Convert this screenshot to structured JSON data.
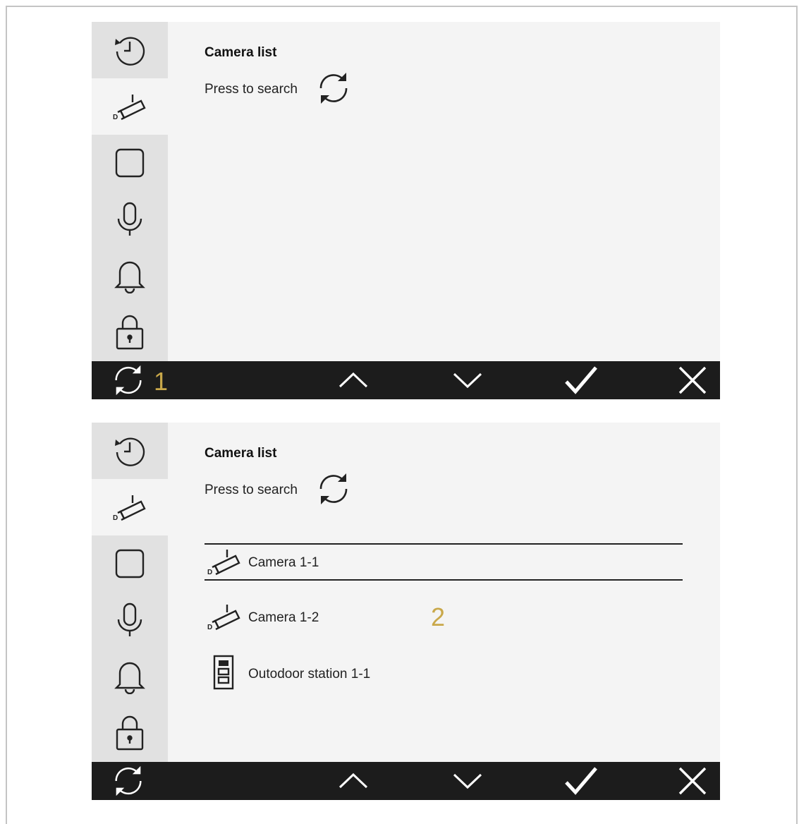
{
  "panels": [
    {
      "content": {
        "title": "Camera list",
        "search_label": "Press to search",
        "items": []
      },
      "callout": "1"
    },
    {
      "content": {
        "title": "Camera list",
        "search_label": "Press to search",
        "items": [
          {
            "icon": "camera-icon",
            "label": "Camera 1-1",
            "selected": true
          },
          {
            "icon": "camera-icon",
            "label": "Camera 1-2",
            "selected": false
          },
          {
            "icon": "outdoor-station-icon",
            "label": "Outodoor station 1-1",
            "selected": false
          }
        ]
      },
      "callout": "2"
    }
  ],
  "sidebar": {
    "items": [
      {
        "icon": "history-icon"
      },
      {
        "icon": "camera-icon",
        "active": true
      },
      {
        "icon": "screen-square-icon"
      },
      {
        "icon": "microphone-icon"
      },
      {
        "icon": "bell-icon"
      },
      {
        "icon": "lock-icon"
      }
    ]
  },
  "toolbar": {
    "buttons": [
      "refresh-icon",
      "arrow-up-icon",
      "arrow-down-icon",
      "check-icon",
      "close-icon"
    ]
  },
  "colors": {
    "panel_bg": "#f4f4f4",
    "sidebar_bg": "#e1e1e1",
    "toolbar_bg": "#1c1c1c",
    "callout": "#c9a84a"
  }
}
